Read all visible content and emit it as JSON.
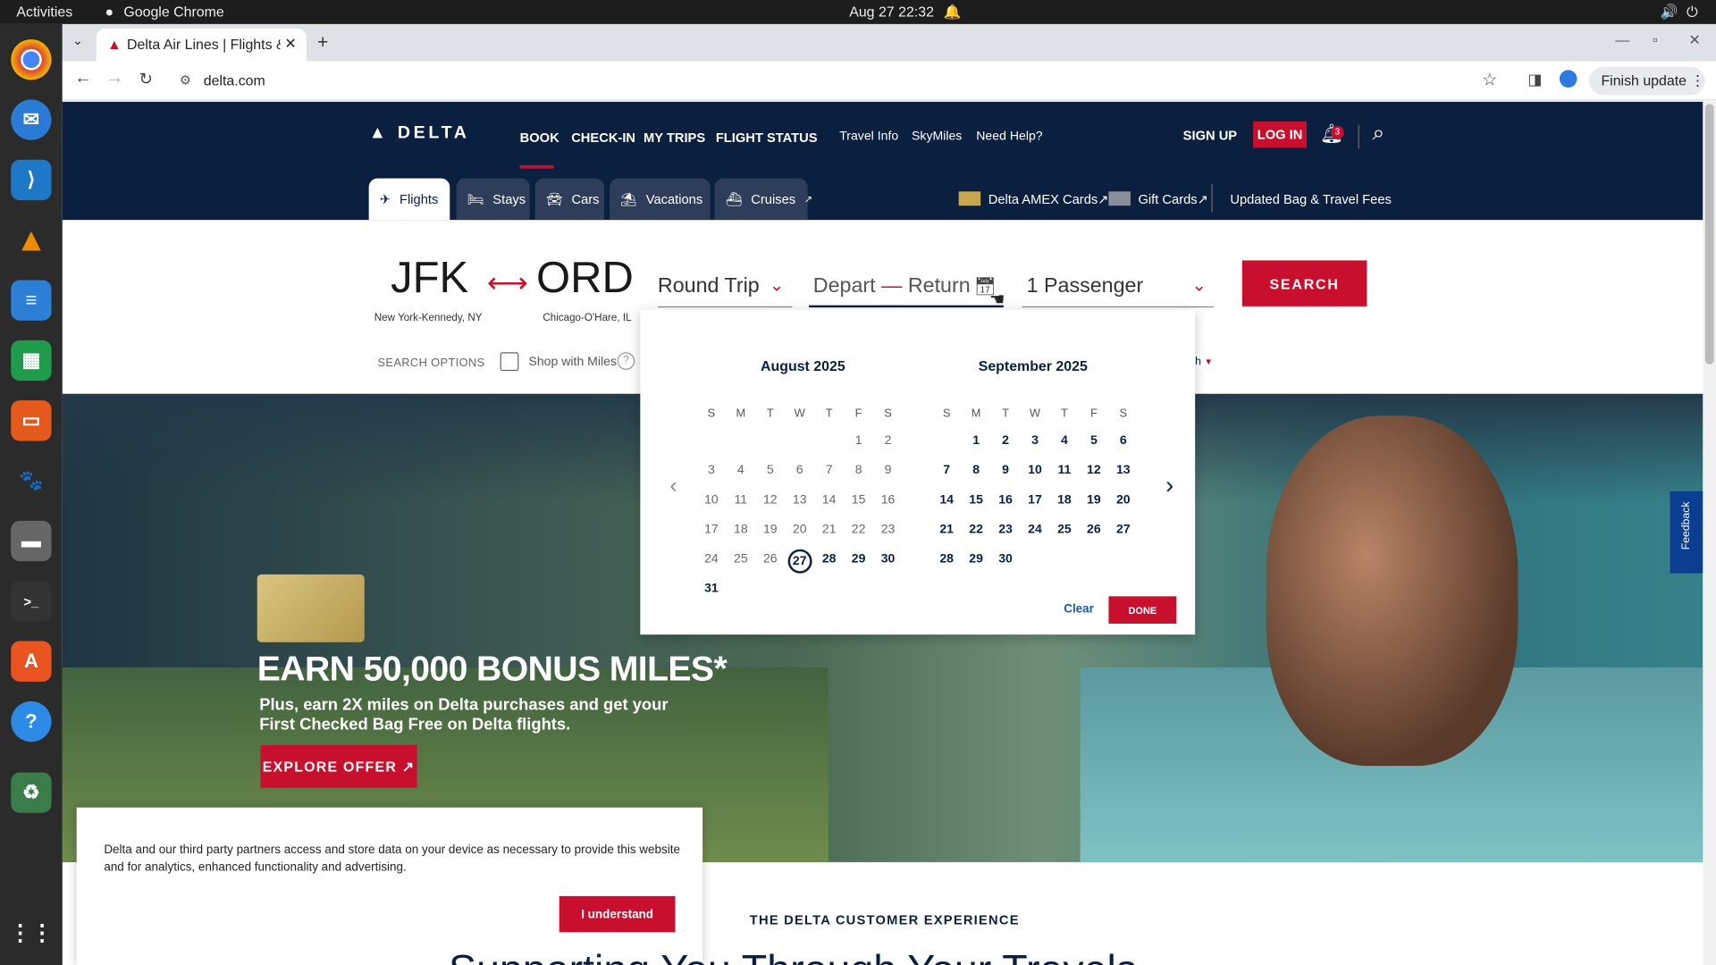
{
  "os": {
    "activities": "Activities",
    "app_name": "Google Chrome",
    "clock": "Aug 27  22:32"
  },
  "browser": {
    "tab_title": "Delta Air Lines | Flights &",
    "url": "delta.com",
    "finish_update": "Finish update"
  },
  "header": {
    "logo": "DELTA",
    "nav": [
      "BOOK",
      "CHECK-IN",
      "MY TRIPS",
      "FLIGHT STATUS"
    ],
    "nav2": [
      "Travel Info",
      "SkyMiles",
      "Need Help?"
    ],
    "sign_up": "SIGN UP",
    "log_in": "LOG IN",
    "notifications_count": "3"
  },
  "subnav": {
    "tabs": [
      "Flights",
      "Stays",
      "Cars",
      "Vacations",
      "Cruises"
    ],
    "amex": "Delta AMEX Cards",
    "gift": "Gift Cards",
    "fees": "Updated Bag & Travel Fees"
  },
  "booking": {
    "from_code": "JFK",
    "from_city": "New York-Kennedy, NY",
    "to_code": "ORD",
    "to_city": "Chicago-O'Hare, IL",
    "trip_type": "Round Trip",
    "depart": "Depart",
    "return": "Return",
    "passengers": "1 Passenger",
    "search": "SEARCH",
    "search_options": "SEARCH OPTIONS",
    "shop_with_miles": "Shop with Miles"
  },
  "calendar": {
    "weekdays": [
      "S",
      "M",
      "T",
      "W",
      "T",
      "F",
      "S"
    ],
    "month1": {
      "name": "August 2025",
      "weeks": [
        [
          "",
          "",
          "",
          "",
          "",
          "1",
          "2"
        ],
        [
          "3",
          "4",
          "5",
          "6",
          "7",
          "8",
          "9"
        ],
        [
          "10",
          "11",
          "12",
          "13",
          "14",
          "15",
          "16"
        ],
        [
          "17",
          "18",
          "19",
          "20",
          "21",
          "22",
          "23"
        ],
        [
          "24",
          "25",
          "26",
          "27",
          "28",
          "29",
          "30"
        ],
        [
          "31",
          "",
          "",
          "",
          "",
          "",
          ""
        ]
      ],
      "today": "27"
    },
    "month2": {
      "name": "September 2025",
      "weeks": [
        [
          "",
          "1",
          "2",
          "3",
          "4",
          "5",
          "6"
        ],
        [
          "7",
          "8",
          "9",
          "10",
          "11",
          "12",
          "13"
        ],
        [
          "14",
          "15",
          "16",
          "17",
          "18",
          "19",
          "20"
        ],
        [
          "21",
          "22",
          "23",
          "24",
          "25",
          "26",
          "27"
        ],
        [
          "28",
          "29",
          "30",
          "",
          "",
          "",
          ""
        ]
      ]
    },
    "clear": "Clear",
    "done": "DONE"
  },
  "hero": {
    "headline": "EARN 50,000 BONUS MILES*",
    "sub1": "Plus, earn 2X miles on Delta purchases and get your",
    "sub2": "First Checked Bag Free on Delta flights.",
    "cta": "EXPLORE OFFER",
    "feedback": "Feedback"
  },
  "cookie": {
    "text1": "Delta and our third party partners access and store data on your device as necessary to provide this website",
    "text2": "and for analytics, enhanced functionality and advertising.",
    "button": "I understand"
  },
  "experience": {
    "label": "THE DELTA CUSTOMER EXPERIENCE",
    "title": "Supporting You Through Your Travels"
  }
}
